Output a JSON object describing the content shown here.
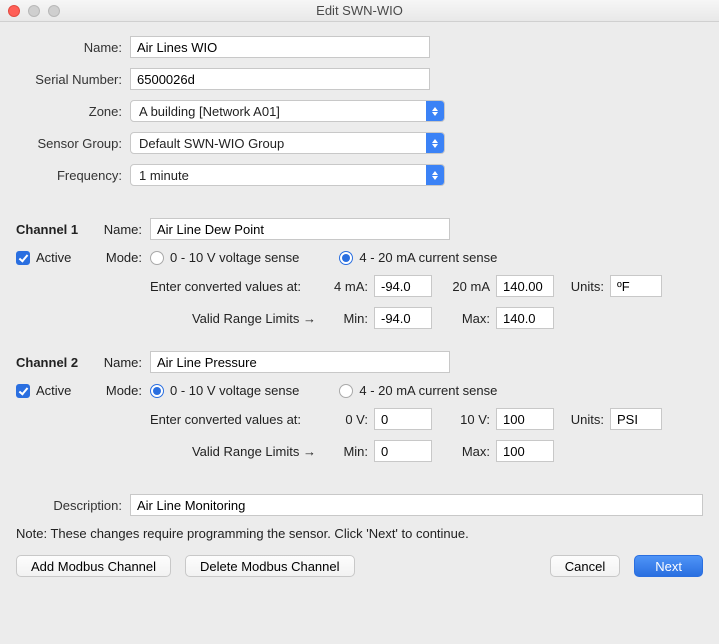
{
  "window": {
    "title": "Edit SWN-WIO"
  },
  "fields": {
    "name_label": "Name:",
    "name_value": "Air Lines WIO",
    "serial_label": "Serial Number:",
    "serial_value": "6500026d",
    "zone_label": "Zone:",
    "zone_value": "A building [Network A01]",
    "group_label": "Sensor Group:",
    "group_value": "Default SWN-WIO Group",
    "freq_label": "Frequency:",
    "freq_value": "1 minute",
    "desc_label": "Description:",
    "desc_value": "Air Line Monitoring"
  },
  "channel_labels": {
    "name": "Name:",
    "active": "Active",
    "mode": "Mode:",
    "voltage_mode": "0 - 10 V voltage sense",
    "current_mode": "4 - 20 mA current sense",
    "enter_conv": "Enter converted values at:",
    "valid_range": "Valid Range Limits →",
    "units": "Units:",
    "min": "Min:",
    "max": "Max:"
  },
  "channels": [
    {
      "header": "Channel 1",
      "name": "Air Line Dew Point",
      "active": true,
      "mode": "current",
      "low_label": "4 mA:",
      "high_label": "20 mA",
      "low_val": "-94.0",
      "high_val": "140.00",
      "units": "ºF",
      "min": "-94.0",
      "max": "140.0"
    },
    {
      "header": "Channel 2",
      "name": "Air Line Pressure",
      "active": true,
      "mode": "voltage",
      "low_label": "0 V:",
      "high_label": "10 V:",
      "low_val": "0",
      "high_val": "100",
      "units": "PSI",
      "min": "0",
      "max": "100"
    }
  ],
  "note": "Note: These changes require programming the sensor. Click 'Next' to continue.",
  "buttons": {
    "add_modbus": "Add Modbus Channel",
    "del_modbus": "Delete Modbus Channel",
    "cancel": "Cancel",
    "next": "Next"
  }
}
